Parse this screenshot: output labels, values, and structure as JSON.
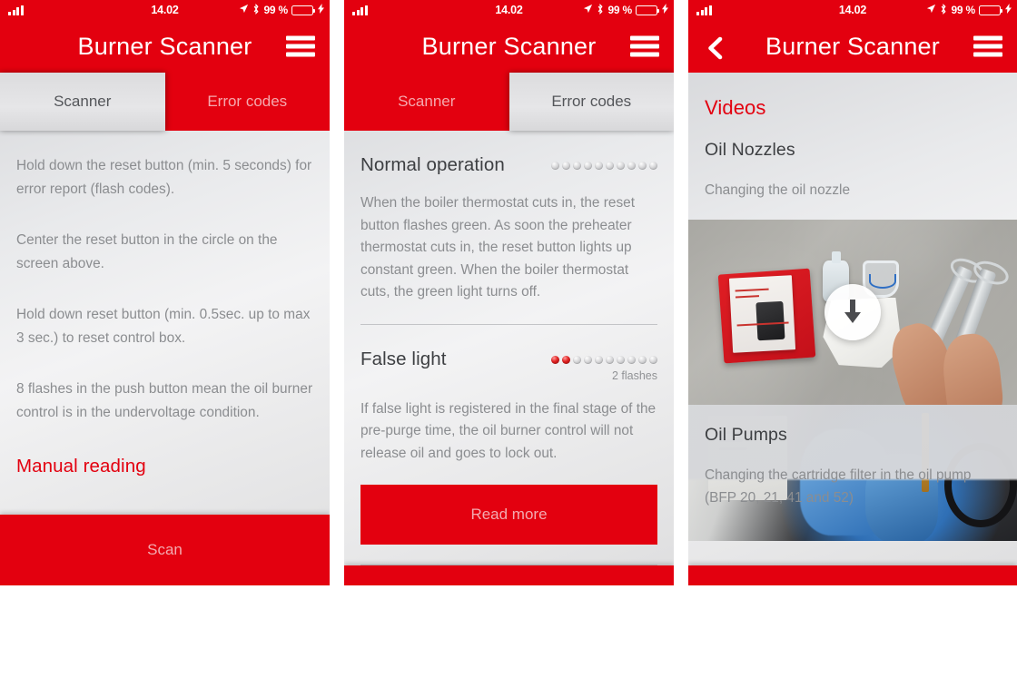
{
  "status_bar": {
    "time": "14.02",
    "battery_percent": "99 %",
    "icons": [
      "signal-bars-icon",
      "location-arrow-icon",
      "bluetooth-icon",
      "battery-icon",
      "charging-bolt-icon"
    ]
  },
  "app": {
    "title": "Burner Scanner",
    "menu_icon": "hamburger-menu-icon",
    "back_icon": "chevron-left-icon"
  },
  "panel1": {
    "tabs": [
      {
        "label": "Scanner",
        "active": true
      },
      {
        "label": "Error codes",
        "active": false
      }
    ],
    "paragraphs": [
      "Hold down the reset button (min. 5 seconds) for error report (flash codes).",
      "Center the reset button in the circle on the screen above.",
      "Hold down reset button (min. 0.5sec. up to max 3 sec.) to reset control box.",
      "8 flashes in the push button mean the oil burner control is in the undervoltage condition."
    ],
    "manual_link": "Manual reading",
    "scan_button": "Scan"
  },
  "panel2": {
    "tabs": [
      {
        "label": "Scanner",
        "active": false
      },
      {
        "label": "Error codes",
        "active": true
      }
    ],
    "sections": [
      {
        "title": "Normal operation",
        "leds_total": 10,
        "leds_on": 0,
        "flashes_label": "",
        "body": "When the boiler thermostat cuts in, the reset button flashes green. As soon the preheater thermostat cuts in, the reset button lights up constant green. When the boiler thermostat cuts, the green light turns off."
      },
      {
        "title": "False light",
        "leds_total": 10,
        "leds_on": 2,
        "flashes_label": "2 flashes",
        "body": "If false light is registered in the final stage of the pre-purge time, the oil burner control will not release oil and goes to lock out."
      }
    ],
    "read_more_button": "Read more"
  },
  "panel3": {
    "heading": "Videos",
    "items": [
      {
        "title": "Oil Nozzles",
        "subtitle": "Changing the oil nozzle",
        "thumbnail": "oil-nozzle-workbench-thumbnail",
        "play_icon": "download-arrow-icon"
      },
      {
        "title": "Oil Pumps",
        "subtitle": "Changing the cartridge filter in the oil pump (BFP 20, 21, 41 and 52)",
        "thumbnail": "oil-pump-gloves-thumbnail",
        "play_icon": ""
      }
    ]
  },
  "colors": {
    "brand_red": "#e3000f",
    "tab_active_text": "#54565a",
    "tab_inactive_text": "#f5a8ae",
    "body_text": "#8b8d90",
    "heading_text": "#3d3f42",
    "led_on": "#e02020",
    "battery_green": "#3ce24b"
  }
}
